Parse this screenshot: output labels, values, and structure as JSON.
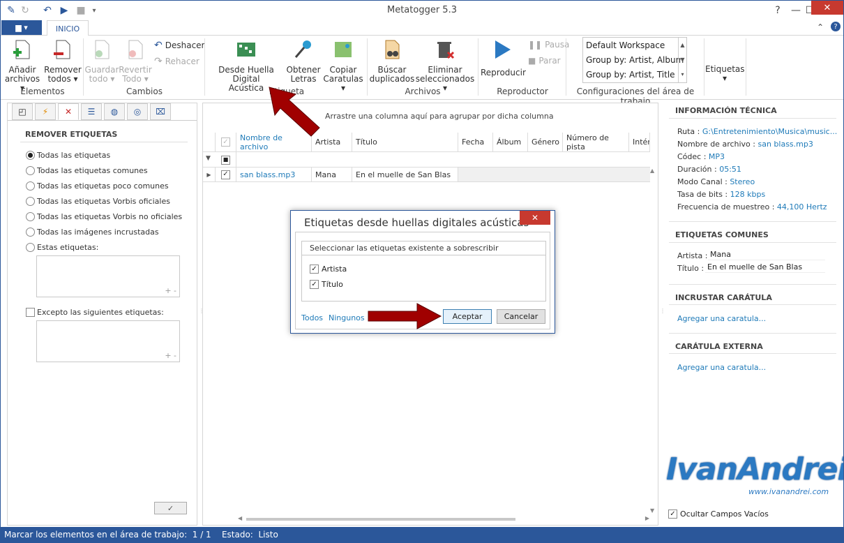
{
  "window": {
    "title": "Metatogger 5.3"
  },
  "tabs": {
    "file": "▆ ▾",
    "inicio": "INICIO"
  },
  "ribbon": {
    "elementos": {
      "add1": "Añadir",
      "add2": "archivos ▾",
      "rem1": "Remover",
      "rem2": "todos ▾",
      "label": "Elementos"
    },
    "cambios": {
      "save1": "Guardar",
      "save2": "todo ▾",
      "rev1": "Revertir",
      "rev2": "Todo ▾",
      "undo": "Deshacer",
      "redo": "Rehacer",
      "label": "Cambios"
    },
    "etiqueta": {
      "fp1": "Desde Huella Digital",
      "fp2": "Acústica",
      "lyr1": "Obtener",
      "lyr2": "Letras",
      "cov1": "Copiar",
      "cov2": "Caratulas ▾",
      "label": "Etiqueta"
    },
    "archivos": {
      "dup1": "Búscar",
      "dup2": "duplicados",
      "del1": "Eliminar",
      "del2": "seleccionados ▾",
      "label": "Archivos"
    },
    "reproductor": {
      "play": "Reproducir",
      "pause": "Pausa",
      "stop": "Parar",
      "label": "Reproductor"
    },
    "workspace": {
      "items": [
        "Default Workspace",
        "Group by: Artist, Album",
        "Group by: Artist, Title"
      ],
      "label": "Configuraciones del área de trabajo"
    },
    "etiquetas": {
      "label": "Etiquetas ▾"
    }
  },
  "left_panel": {
    "heading": "REMOVER ETIQUETAS",
    "options": [
      "Todas las etiquetas",
      "Todas las etiquetas comunes",
      "Todas las etiquetas poco comunes",
      "Todas las etiquetas Vorbis oficiales",
      "Todas las etiquetas Vorbis no oficiales",
      "Todas las imágenes incrustadas",
      "Estas etiquetas:"
    ],
    "except": "Excepto las siguientes etiquetas:",
    "pm": "+ -",
    "apply": "✓"
  },
  "grid": {
    "group_hint": "Arrastre una columna aquí para agrupar por dicha columna",
    "columns": [
      "Nombre de archivo",
      "Artista",
      "Título",
      "Fecha",
      "Álbum",
      "Género",
      "Número de pista",
      "Intér"
    ],
    "row": {
      "file": "san blass.mp3",
      "artist": "Mana",
      "title": "En el muelle de San Blas"
    }
  },
  "right_panel": {
    "tech_heading": "INFORMACIÓN TÉCNICA",
    "tech": [
      {
        "k": "Ruta : ",
        "v": "G:\\Entretenimiento\\Musica\\music..."
      },
      {
        "k": "Nombre de archivo : ",
        "v": "san blass.mp3"
      },
      {
        "k": "Códec : ",
        "v": "MP3"
      },
      {
        "k": "Duración : ",
        "v": "05:51"
      },
      {
        "k": "Modo Canal : ",
        "v": "Stereo"
      },
      {
        "k": "Tasa de bits : ",
        "v": "128 kbps"
      },
      {
        "k": "Frecuencia de muestreo : ",
        "v": "44,100 Hertz"
      }
    ],
    "common_heading": "ETIQUETAS COMUNES",
    "artist_k": "Artista : ",
    "artist_v": "Mana",
    "title_k": "Título : ",
    "title_v": "En el muelle de San Blas",
    "embed_heading": "INCRUSTAR CARÁTULA",
    "embed_link": "Agregar una caratula...",
    "ext_heading": "CARÁTULA EXTERNA",
    "ext_link": "Agregar una caratula...",
    "hide_empty": "Ocultar Campos Vacíos",
    "watermark": "IvanAndrei",
    "watermark_url": "www.ivanandrei.com"
  },
  "dialog": {
    "title": "Etiquetas desde huellas digitales acústicas",
    "group": "Seleccionar las etiquetas existente a sobrescribir",
    "opt1": "Artista",
    "opt2": "Título",
    "all": "Todos",
    "none": "Ningunos",
    "ok": "Aceptar",
    "cancel": "Cancelar"
  },
  "status": {
    "text": "Marcar los elementos en el área de trabajo:  1 / 1    Estado:  Listo"
  }
}
